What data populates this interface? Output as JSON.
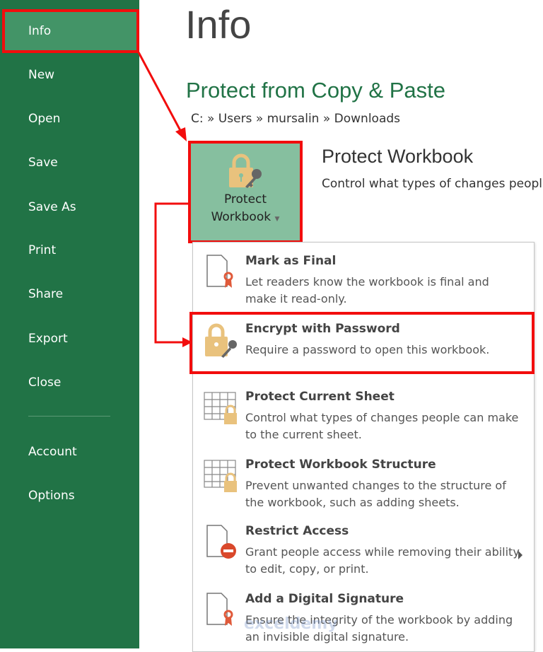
{
  "sidebar": {
    "items": [
      {
        "label": "Info",
        "selected": true
      },
      {
        "label": "New"
      },
      {
        "label": "Open"
      },
      {
        "label": "Save"
      },
      {
        "label": "Save As"
      },
      {
        "label": "Print"
      },
      {
        "label": "Share"
      },
      {
        "label": "Export"
      },
      {
        "label": "Close"
      },
      {
        "label": "Account"
      },
      {
        "label": "Options"
      }
    ]
  },
  "main": {
    "title": "Info",
    "file_name": "Protect from Copy & Paste",
    "path": "C: » Users » mursalin » Downloads",
    "protect_button": {
      "line1": "Protect",
      "line2": "Workbook",
      "icon": "lock-key-icon"
    },
    "protect_heading": "Protect Workbook",
    "protect_desc": "Control what types of changes peopl"
  },
  "menu": {
    "items": [
      {
        "title": "Mark as Final",
        "desc": "Let readers know the workbook is final and make it read-only.",
        "icon": "document-ribbon-icon"
      },
      {
        "title": "Encrypt with Password",
        "desc": "Require a password to open this workbook.",
        "icon": "lock-key-icon",
        "highlighted": true
      },
      {
        "title": "Protect Current Sheet",
        "desc": "Control what types of changes people can make to the current sheet.",
        "icon": "sheet-lock-icon"
      },
      {
        "title": "Protect Workbook Structure",
        "desc": "Prevent unwanted changes to the structure of the workbook, such as adding sheets.",
        "icon": "sheet-lock-icon"
      },
      {
        "title": "Restrict Access",
        "desc": "Grant people access while removing their ability to edit, copy, or print.",
        "icon": "document-no-entry-icon",
        "submenu": true
      },
      {
        "title": "Add a Digital Signature",
        "desc": "Ensure the integrity of the workbook by adding an invisible digital signature.",
        "icon": "document-ribbon-icon"
      }
    ]
  },
  "watermark": "exceldemy",
  "colors": {
    "sidebar": "#217346",
    "selected": "#439467",
    "accent": "#217346",
    "annotation": "#f20d0d",
    "lock": "#e9c27d"
  }
}
